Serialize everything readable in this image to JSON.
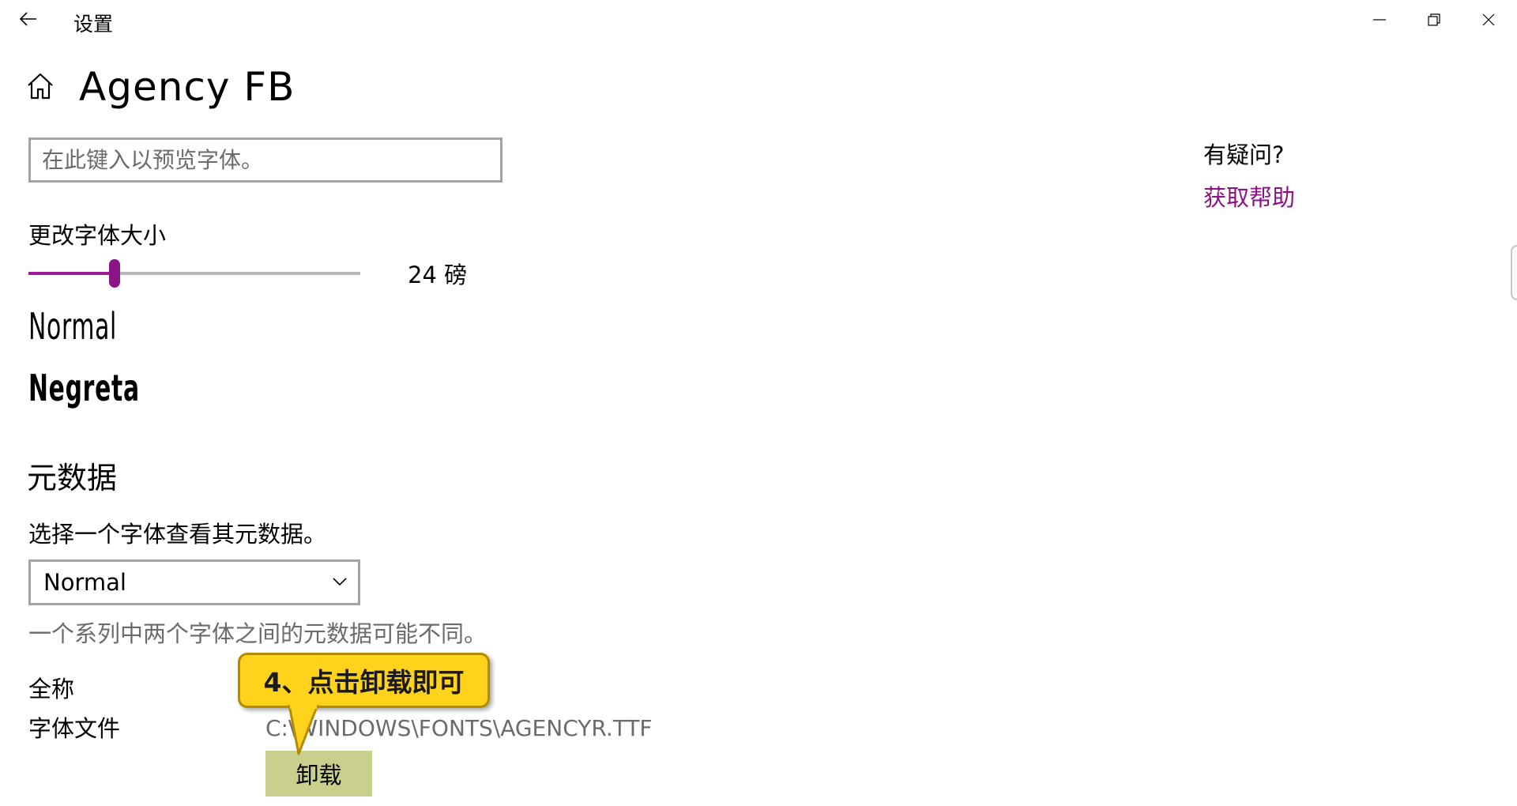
{
  "window": {
    "title": "设置",
    "back_icon": "arrow-left-icon",
    "minimize_icon": "minimize-icon",
    "maximize_icon": "restore-icon",
    "close_icon": "close-icon"
  },
  "header": {
    "home_icon": "home-icon",
    "title": "Agency FB"
  },
  "preview": {
    "placeholder": "在此键入以预览字体。"
  },
  "size": {
    "label": "更改字体大小",
    "value_text": "24 磅",
    "slider_fraction": 0.26,
    "accent": "#8a1386"
  },
  "samples": {
    "normal": "Normal",
    "bold": "Negreta"
  },
  "metadata": {
    "title": "元数据",
    "description": "选择一个字体查看其元数据。",
    "selected_style": "Normal",
    "note": "一个系列中两个字体之间的元数据可能不同。",
    "fullname_label": "全称",
    "fontfile_label": "字体文件",
    "fontfile_path": "C:\\WINDOWS\\FONTS\\AGENCYR.TTF"
  },
  "uninstall": {
    "label": "卸载"
  },
  "callout": {
    "text": "4、点击卸载即可",
    "color": "#ffd21c"
  },
  "help": {
    "question": "有疑问?",
    "link": "获取帮助",
    "link_color": "#8a1386"
  }
}
